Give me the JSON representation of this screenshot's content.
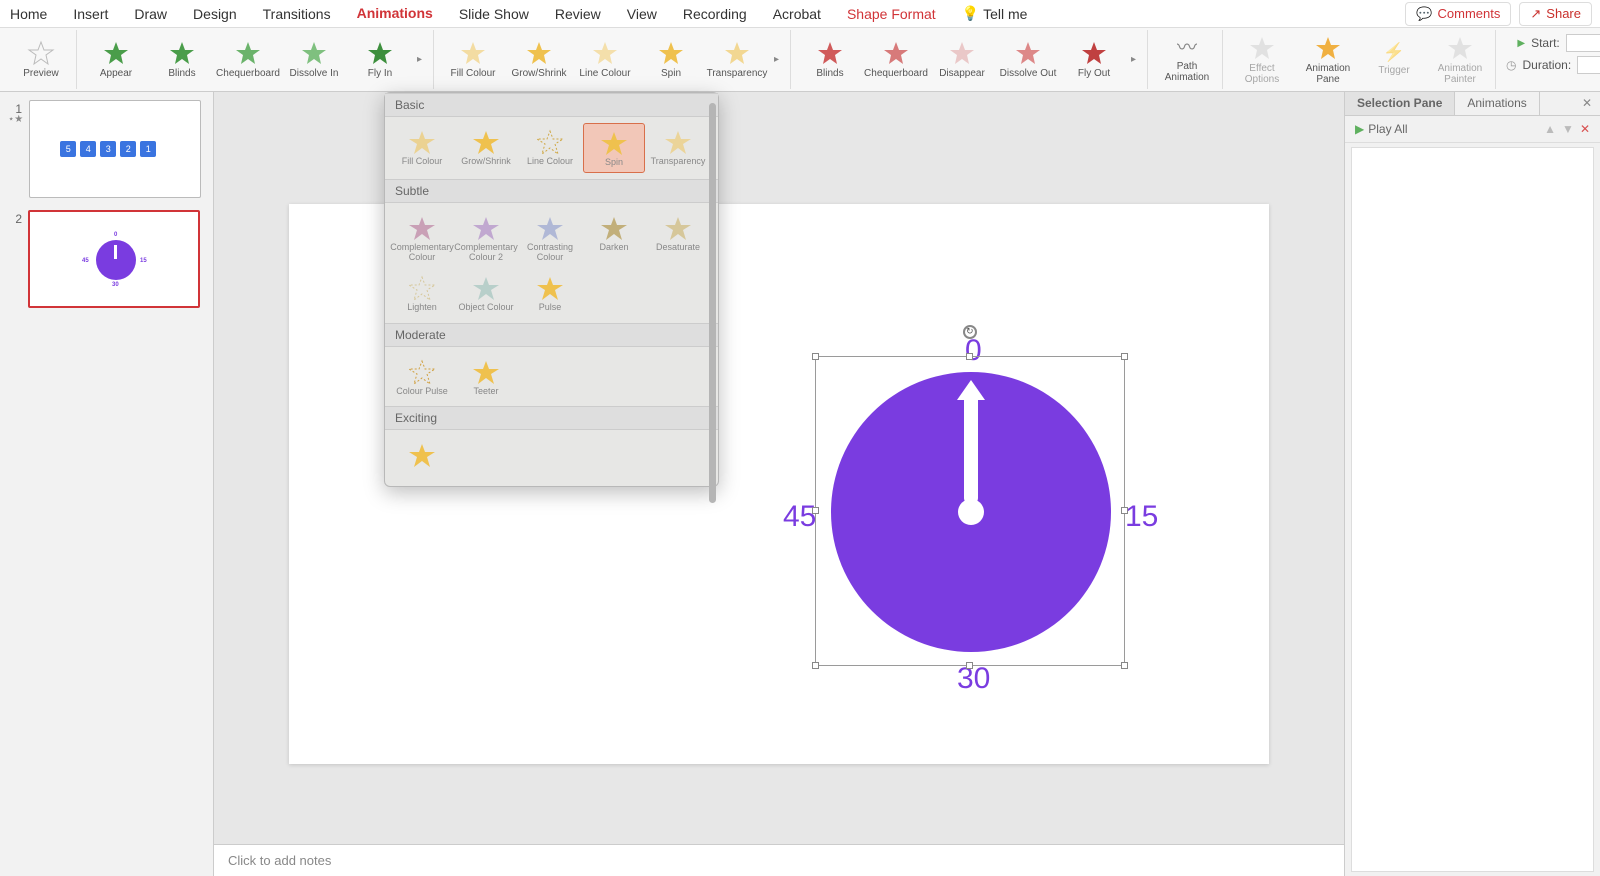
{
  "tabs": {
    "home": "Home",
    "insert": "Insert",
    "draw": "Draw",
    "design": "Design",
    "transitions": "Transitions",
    "animations": "Animations",
    "slideshow": "Slide Show",
    "review": "Review",
    "view": "View",
    "recording": "Recording",
    "acrobat": "Acrobat",
    "shapeformat": "Shape Format",
    "tellme": "Tell me"
  },
  "topbuttons": {
    "comments": "Comments",
    "share": "Share"
  },
  "ribbon": {
    "preview": "Preview",
    "entrance": [
      "Appear",
      "Blinds",
      "Chequerboard",
      "Dissolve In",
      "Fly In"
    ],
    "emphasis": [
      "Fill Colour",
      "Grow/Shrink",
      "Line Colour",
      "Spin",
      "Transparency"
    ],
    "exit": [
      "Blinds",
      "Chequerboard",
      "Disappear",
      "Dissolve Out",
      "Fly Out"
    ],
    "path": "Path Animation",
    "effectopts": "Effect Options",
    "animpane": "Animation Pane",
    "trigger": "Trigger",
    "animpainter": "Animation Painter",
    "timing": {
      "startlbl": "Start:",
      "durationlbl": "Duration:",
      "startval": "",
      "durationval": ""
    }
  },
  "popup": {
    "categories": {
      "basic": "Basic",
      "subtle": "Subtle",
      "moderate": "Moderate",
      "exciting": "Exciting"
    },
    "basic": [
      "Fill Colour",
      "Grow/Shrink",
      "Line Colour",
      "Spin",
      "Transparency"
    ],
    "subtle": [
      "Complementary Colour",
      "Complementary Colour 2",
      "Contrasting Colour",
      "Darken",
      "Desaturate",
      "Lighten",
      "Object Colour",
      "Pulse"
    ],
    "moderate": [
      "Colour Pulse",
      "Teeter"
    ],
    "selected": "Spin"
  },
  "thumbs": {
    "n1": "1",
    "n2": "2",
    "blocks": [
      "5",
      "4",
      "3",
      "2",
      "1"
    ],
    "mini": {
      "t": "0",
      "r": "15",
      "b": "30",
      "l": "45"
    }
  },
  "clock": {
    "t": "0",
    "r": "15",
    "b": "30",
    "l": "45"
  },
  "notes": "Click to add notes",
  "rightpane": {
    "selectionpane": "Selection Pane",
    "animations": "Animations",
    "playall": "Play All"
  }
}
